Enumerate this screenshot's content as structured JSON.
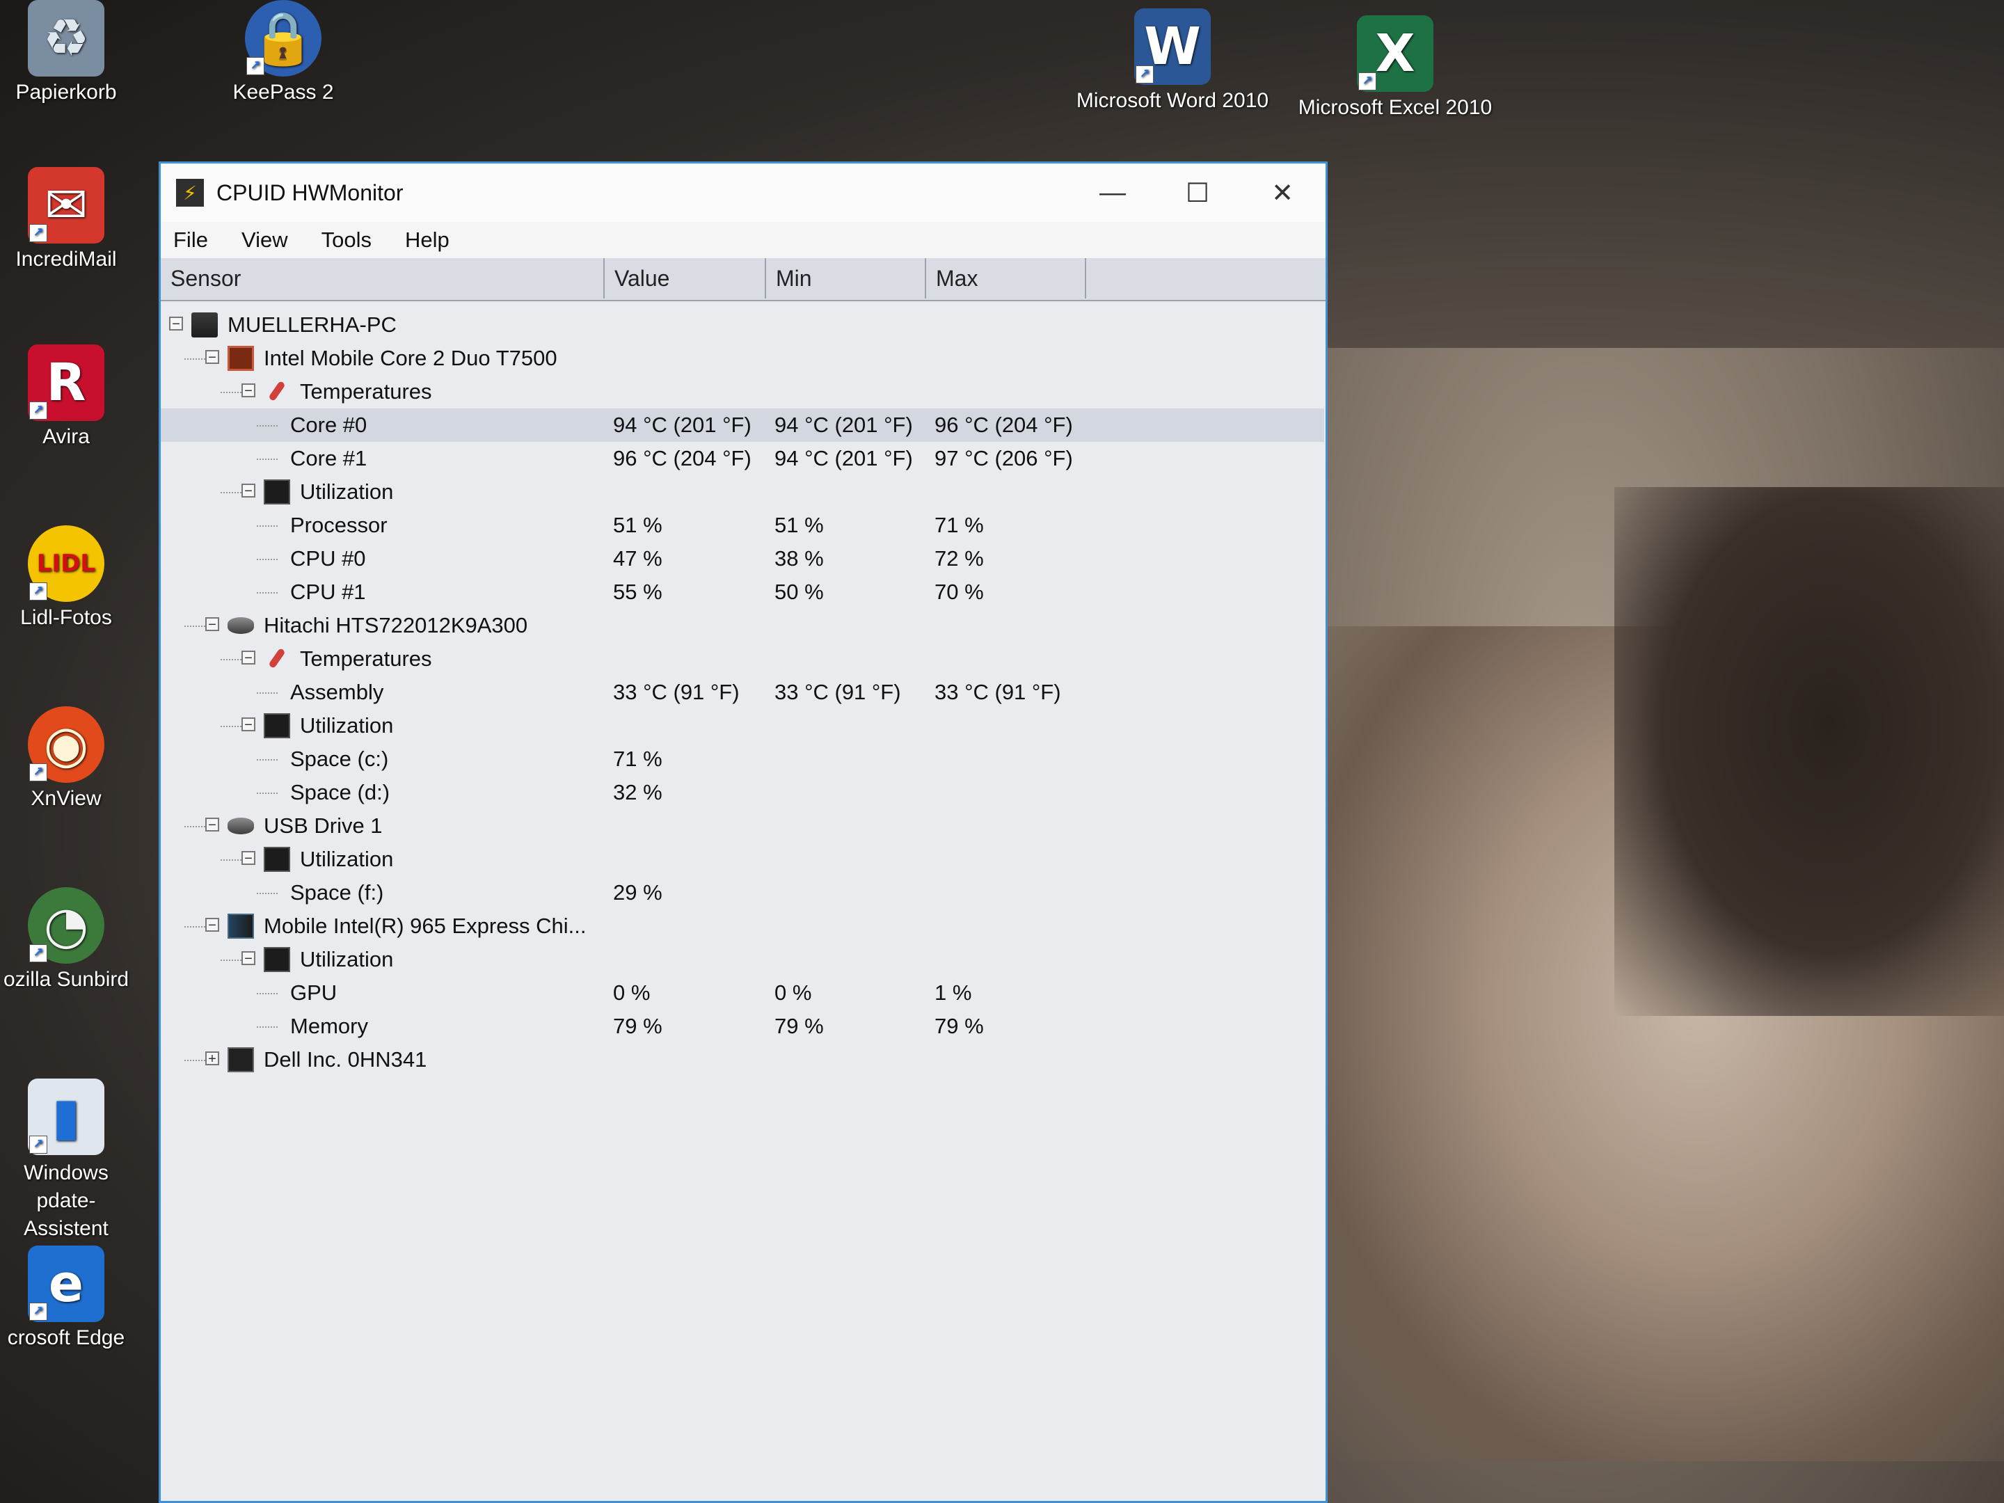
{
  "desktop": {
    "icons": [
      {
        "label": "Papierkorb",
        "icon": "recycle-bin-icon"
      },
      {
        "label": "KeePass 2",
        "icon": "keepass-lock-icon"
      },
      {
        "label": "Microsoft Word 2010",
        "icon": "word-icon"
      },
      {
        "label": "Microsoft Excel 2010",
        "icon": "excel-icon"
      },
      {
        "label": "IncrediMail",
        "icon": "incredimail-envelope-icon"
      },
      {
        "label": "Avira",
        "icon": "avira-umbrella-icon"
      },
      {
        "label": "Lidl-Fotos",
        "icon": "lidl-icon"
      },
      {
        "label": "XnView",
        "icon": "xnview-eye-icon"
      },
      {
        "label": "ozilla Sunbird",
        "icon": "sunbird-icon"
      },
      {
        "label": "Windows\npdate-Assistent",
        "icon": "windows-update-icon"
      },
      {
        "label": "crosoft Edge",
        "icon": "edge-icon"
      }
    ]
  },
  "window": {
    "title": "CPUID HWMonitor",
    "minimize": "—",
    "maximize": "☐",
    "close": "✕",
    "menu": [
      "File",
      "View",
      "Tools",
      "Help"
    ],
    "columns": [
      "Sensor",
      "Value",
      "Min",
      "Max"
    ]
  },
  "rows": [
    {
      "level": 0,
      "toggle": "−",
      "icon": "pc",
      "name": "MUELLERHA-PC",
      "value": "",
      "min": "",
      "max": ""
    },
    {
      "level": 1,
      "toggle": "−",
      "icon": "cpu",
      "name": "Intel Mobile Core 2 Duo T7500",
      "value": "",
      "min": "",
      "max": ""
    },
    {
      "level": 2,
      "toggle": "−",
      "icon": "temp",
      "name": "Temperatures",
      "value": "",
      "min": "",
      "max": ""
    },
    {
      "level": 3,
      "toggle": "",
      "icon": "",
      "name": "Core #0",
      "value": "94 °C  (201 °F)",
      "min": "94 °C  (201 °F)",
      "max": "96 °C  (204 °F)",
      "selected": true
    },
    {
      "level": 3,
      "toggle": "",
      "icon": "",
      "name": "Core #1",
      "value": "96 °C  (204 °F)",
      "min": "94 °C  (201 °F)",
      "max": "97 °C  (206 °F)"
    },
    {
      "level": 2,
      "toggle": "−",
      "icon": "util",
      "name": "Utilization",
      "value": "",
      "min": "",
      "max": ""
    },
    {
      "level": 3,
      "toggle": "",
      "icon": "",
      "name": "Processor",
      "value": "51 %",
      "min": "51 %",
      "max": "71 %"
    },
    {
      "level": 3,
      "toggle": "",
      "icon": "",
      "name": "CPU #0",
      "value": "47 %",
      "min": "38 %",
      "max": "72 %"
    },
    {
      "level": 3,
      "toggle": "",
      "icon": "",
      "name": "CPU #1",
      "value": "55 %",
      "min": "50 %",
      "max": "70 %"
    },
    {
      "level": 1,
      "toggle": "−",
      "icon": "disk",
      "name": "Hitachi HTS722012K9A300",
      "value": "",
      "min": "",
      "max": ""
    },
    {
      "level": 2,
      "toggle": "−",
      "icon": "temp",
      "name": "Temperatures",
      "value": "",
      "min": "",
      "max": ""
    },
    {
      "level": 3,
      "toggle": "",
      "icon": "",
      "name": "Assembly",
      "value": "33 °C  (91 °F)",
      "min": "33 °C  (91 °F)",
      "max": "33 °C  (91 °F)"
    },
    {
      "level": 2,
      "toggle": "−",
      "icon": "util",
      "name": "Utilization",
      "value": "",
      "min": "",
      "max": ""
    },
    {
      "level": 3,
      "toggle": "",
      "icon": "",
      "name": "Space (c:)",
      "value": "71 %",
      "min": "",
      "max": ""
    },
    {
      "level": 3,
      "toggle": "",
      "icon": "",
      "name": "Space (d:)",
      "value": "32 %",
      "min": "",
      "max": ""
    },
    {
      "level": 1,
      "toggle": "−",
      "icon": "disk",
      "name": "USB Drive 1",
      "value": "",
      "min": "",
      "max": ""
    },
    {
      "level": 2,
      "toggle": "−",
      "icon": "util",
      "name": "Utilization",
      "value": "",
      "min": "",
      "max": ""
    },
    {
      "level": 3,
      "toggle": "",
      "icon": "",
      "name": "Space (f:)",
      "value": "29 %",
      "min": "",
      "max": ""
    },
    {
      "level": 1,
      "toggle": "−",
      "icon": "gpu",
      "name": "Mobile Intel(R) 965 Express Chi...",
      "value": "",
      "min": "",
      "max": ""
    },
    {
      "level": 2,
      "toggle": "−",
      "icon": "util",
      "name": "Utilization",
      "value": "",
      "min": "",
      "max": ""
    },
    {
      "level": 3,
      "toggle": "",
      "icon": "",
      "name": "GPU",
      "value": "0 %",
      "min": "0 %",
      "max": "1 %"
    },
    {
      "level": 3,
      "toggle": "",
      "icon": "",
      "name": "Memory",
      "value": "79 %",
      "min": "79 %",
      "max": "79 %"
    },
    {
      "level": 1,
      "toggle": "+",
      "icon": "board",
      "name": "Dell Inc. 0HN341",
      "value": "",
      "min": "",
      "max": ""
    }
  ]
}
